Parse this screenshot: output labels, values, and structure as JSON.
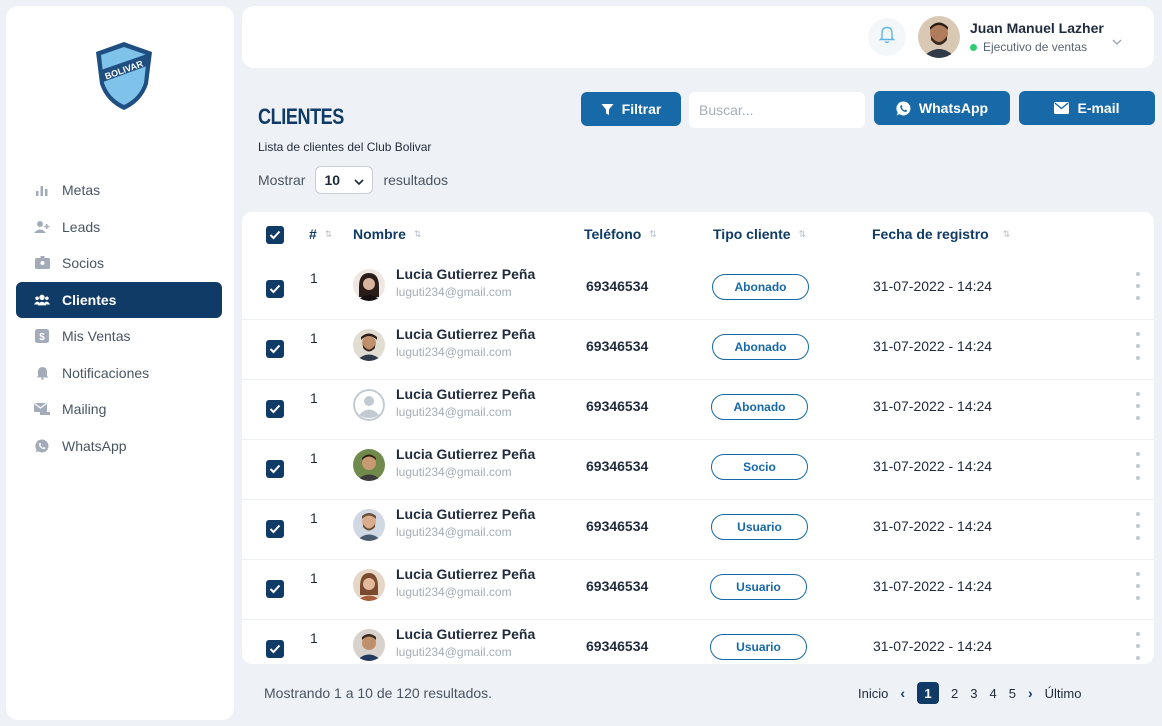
{
  "sidebar": {
    "logo_text": "BOLIVAR",
    "items": [
      {
        "label": "Metas",
        "icon": "bar-chart-icon",
        "active": false
      },
      {
        "label": "Leads",
        "icon": "add-user-icon",
        "active": false
      },
      {
        "label": "Socios",
        "icon": "id-card-icon",
        "active": false
      },
      {
        "label": "Clientes",
        "icon": "users-icon",
        "active": true
      },
      {
        "label": "Mis Ventas",
        "icon": "dollar-icon",
        "active": false
      },
      {
        "label": "Notificaciones",
        "icon": "bell-icon",
        "active": false
      },
      {
        "label": "Mailing",
        "icon": "mailing-icon",
        "active": false
      },
      {
        "label": "WhatsApp",
        "icon": "whatsapp-icon",
        "active": false
      }
    ]
  },
  "header": {
    "user_name": "Juan Manuel Lazher",
    "user_role": "Ejecutivo de ventas",
    "status_color": "#2ecc71"
  },
  "page": {
    "title": "CLIENTES",
    "subtitle": "Lista de clientes del Club Bolivar",
    "show_label": "Mostrar",
    "show_value": "10",
    "results_label": "resultados"
  },
  "toolbar": {
    "filter_label": "Filtrar",
    "search_placeholder": "Buscar...",
    "whatsapp_label": "WhatsApp",
    "email_label": "E-mail"
  },
  "table": {
    "headers": {
      "num": "#",
      "name": "Nombre",
      "phone": "Teléfono",
      "type": "Tipo cliente",
      "date": "Fecha de registro"
    },
    "rows": [
      {
        "num": "1",
        "name": "Lucia Gutierrez Peña",
        "email": "luguti234@gmail.com",
        "phone": "69346534",
        "type": "Abonado",
        "date": "31-07-2022 - 14:24"
      },
      {
        "num": "1",
        "name": "Lucia Gutierrez Peña",
        "email": "luguti234@gmail.com",
        "phone": "69346534",
        "type": "Abonado",
        "date": "31-07-2022 - 14:24"
      },
      {
        "num": "1",
        "name": "Lucia Gutierrez Peña",
        "email": "luguti234@gmail.com",
        "phone": "69346534",
        "type": "Abonado",
        "date": "31-07-2022 - 14:24"
      },
      {
        "num": "1",
        "name": "Lucia Gutierrez Peña",
        "email": "luguti234@gmail.com",
        "phone": "69346534",
        "type": "Socio",
        "date": "31-07-2022 - 14:24"
      },
      {
        "num": "1",
        "name": "Lucia Gutierrez Peña",
        "email": "luguti234@gmail.com",
        "phone": "69346534",
        "type": "Usuario",
        "date": "31-07-2022 - 14:24"
      },
      {
        "num": "1",
        "name": "Lucia Gutierrez Peña",
        "email": "luguti234@gmail.com",
        "phone": "69346534",
        "type": "Usuario",
        "date": "31-07-2022 - 14:24"
      },
      {
        "num": "1",
        "name": "Lucia Gutierrez Peña",
        "email": "luguti234@gmail.com",
        "phone": "69346534",
        "type": "Usuario",
        "date": "31-07-2022 - 14:24"
      }
    ]
  },
  "footer": {
    "info": "Mostrando 1 a 10 de 120 resultados.",
    "first": "Inicio",
    "pages": [
      "1",
      "2",
      "3",
      "4",
      "5"
    ],
    "current_page": "1",
    "last": "Último"
  },
  "colors": {
    "primary": "#0f3b66",
    "button": "#1769a8",
    "background": "#eef1f5"
  }
}
